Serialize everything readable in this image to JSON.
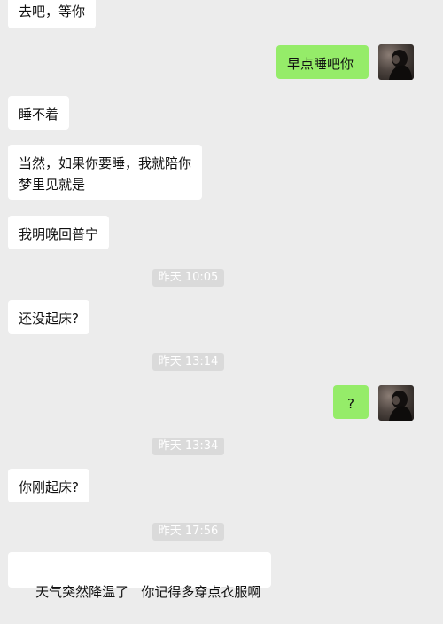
{
  "chat": {
    "msg1": "去吧，等你",
    "msg2": "早点睡吧你",
    "msg3": "睡不着",
    "msg4_line1": "当然，如果你要睡，我就陪你",
    "msg4_line2": "梦里见就是",
    "msg5": "我明晚回普宁",
    "ts1": "昨天 10:05",
    "msg6": "还没起床?",
    "ts2": "昨天 13:14",
    "msg7": "?",
    "ts3": "昨天 13:34",
    "msg8": "你刚起床?",
    "ts4": "昨天 17:56",
    "msg9": "天气突然降温了   你记得多穿点衣服啊"
  },
  "colors": {
    "background": "#ececec",
    "incoming_bubble": "#ffffff",
    "outgoing_bubble": "#95ec69",
    "timestamp_bg": "#dadada"
  }
}
